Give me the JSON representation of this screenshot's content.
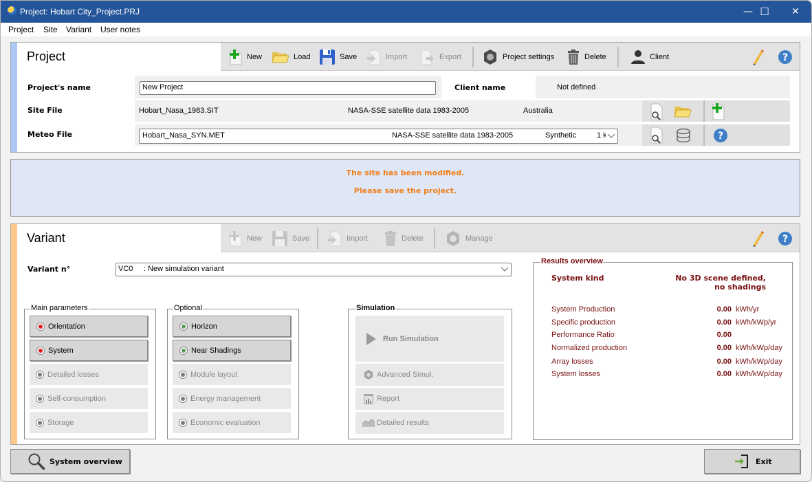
{
  "window": {
    "title": "Project:  Hobart City_Project.PRJ",
    "controls": {
      "minimize": "—",
      "maximize": "☐",
      "close": "✕"
    }
  },
  "menu": [
    "Project",
    "Site",
    "Variant",
    "User notes"
  ],
  "project": {
    "heading": "Project",
    "toolbar": {
      "new": "New",
      "load": "Load",
      "save": "Save",
      "import": "Import",
      "export": "Export",
      "settings": "Project settings",
      "delete": "Delete",
      "client": "Client"
    },
    "name_label": "Project's name",
    "name_value": "New Project",
    "client_label": "Client name",
    "client_value": "Not defined",
    "site_label": "Site File",
    "site_file": "Hobart_Nasa_1983.SIT",
    "site_source": "NASA-SSE satellite data 1983-2005",
    "site_country": "Australia",
    "meteo_label": "Meteo File",
    "meteo_file": "Hobart_Nasa_SYN.MET",
    "meteo_source": "NASA-SSE satellite data 1983-2005",
    "meteo_type": "Synthetic",
    "meteo_extra": "1 k"
  },
  "message": {
    "line1": "The site has been modified.",
    "line2": "Please save the project.",
    "color": "#f07d18"
  },
  "variant": {
    "heading": "Variant",
    "toolbar": {
      "new": "New",
      "save": "Save",
      "import": "Import",
      "delete": "Delete",
      "manage": "Manage"
    },
    "number_label": "Variant n°",
    "number_code": "VC0",
    "number_value": ": New simulation variant",
    "main_parameters": {
      "legend": "Main parameters",
      "items": [
        {
          "label": "Orientation",
          "state": "red"
        },
        {
          "label": "System",
          "state": "red"
        },
        {
          "label": "Detailed losses",
          "state": "disabled"
        },
        {
          "label": "Self-consumption",
          "state": "disabled"
        },
        {
          "label": "Storage",
          "state": "disabled"
        }
      ]
    },
    "optional": {
      "legend": "Optional",
      "items": [
        {
          "label": "Horizon",
          "state": "green"
        },
        {
          "label": "Near Shadings",
          "state": "green"
        },
        {
          "label": "Module layout",
          "state": "disabled"
        },
        {
          "label": "Energy management",
          "state": "disabled"
        },
        {
          "label": "Economic evaluation",
          "state": "disabled"
        }
      ]
    },
    "simulation": {
      "legend": "Simulation",
      "run": "Run Simulation",
      "advanced": "Advanced Simul.",
      "report": "Report",
      "detailed": "Detailed results"
    },
    "results": {
      "legend": "Results overview",
      "system_kind_label": "System kind",
      "system_kind_value": "No 3D scene defined, no shadings",
      "rows": [
        {
          "label": "System Production",
          "value": "0.00",
          "unit": "kWh/yr"
        },
        {
          "label": "Specific production",
          "value": "0.00",
          "unit": "kWh/kWp/yr"
        },
        {
          "label": "Performance Ratio",
          "value": "0.00",
          "unit": ""
        },
        {
          "label": "Normalized production",
          "value": "0.00",
          "unit": "kWh/kWp/day"
        },
        {
          "label": "Array losses",
          "value": "0.00",
          "unit": "kWh/kWp/day"
        },
        {
          "label": "System losses",
          "value": "0.00",
          "unit": "kWh/kWp/day"
        }
      ]
    }
  },
  "footer": {
    "overview": "System overview",
    "exit": "Exit"
  },
  "colors": {
    "titlebar": "#245499",
    "project_stripe": "#a9c6f5",
    "variant_stripe": "#fdc98a",
    "results_text": "#7a1010",
    "led_red": "#e0201e",
    "led_green": "#5a9a5a",
    "led_gray": "#7a7a7a"
  }
}
